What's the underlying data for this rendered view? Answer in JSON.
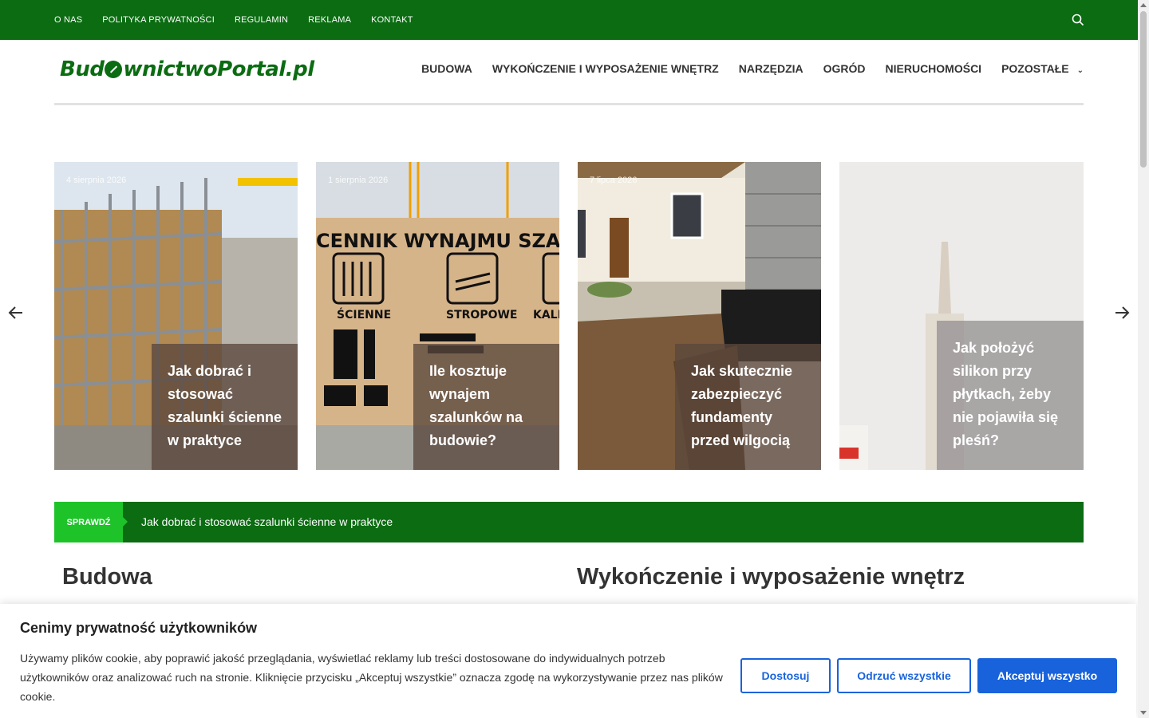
{
  "topbar": {
    "menu": [
      "O NAS",
      "POLITYKA PRYWATNOŚCI",
      "REGULAMIN",
      "REKLAMA",
      "KONTAKT"
    ],
    "search_icon": "search-icon"
  },
  "header": {
    "logo_text_before": "Bud",
    "logo_text_after": "wnictwoPortal.pl",
    "nav": [
      "BUDOWA",
      "WYKOŃCZENIE I WYPOSAŻENIE WNĘTRZ",
      "NARZĘDZIA",
      "OGRÓD",
      "NIERUCHOMOŚCI",
      "POZOSTAŁE"
    ]
  },
  "slider": {
    "slides": [
      {
        "date": "4 sierpnia 2026",
        "title": "Jak dobrać i stosować szalunki ścienne w praktyce"
      },
      {
        "date": "1 sierpnia 2026",
        "title": "Ile kosztuje wynajem szalunków na budowie?"
      },
      {
        "date": "7 lipca 2026",
        "title": "Jak skutecznie zabezpieczyć fundamenty przed wilgocią"
      },
      {
        "date": "",
        "title": "Jak położyć silikon przy płytkach, żeby nie pojawiła się pleśń?"
      }
    ],
    "image_texts": [
      "CENNIK WYNAJMU SZALUNKÓW",
      "ŚCIENNE",
      "STROPOWE",
      "KALKU"
    ],
    "prev_icon": "arrow-left-icon",
    "next_icon": "arrow-right-icon"
  },
  "ticker": {
    "label": "SPRAWDŹ",
    "text": "Jak dobrać i stosować szalunki ścienne w praktyce"
  },
  "sections": {
    "left": "Budowa",
    "right": "Wykończenie i wyposażenie wnętrz"
  },
  "cookie": {
    "title": "Cenimy prywatność użytkowników",
    "text": "Używamy plików cookie, aby poprawić jakość przeglądania, wyświetlać reklamy lub treści dostosowane do indywidualnych potrzeb użytkowników oraz analizować ruch na stronie. Kliknięcie przycisku „Akceptuj wszystkie” oznacza zgodę na wykorzystywanie przez nas plików cookie.",
    "customize": "Dostosuj",
    "reject": "Odrzuć wszystkie",
    "accept": "Akceptuj wszystko"
  },
  "colors": {
    "brand_green": "#0b6c12",
    "ticker_label": "#1ec32a",
    "button_blue": "#1863dc"
  }
}
